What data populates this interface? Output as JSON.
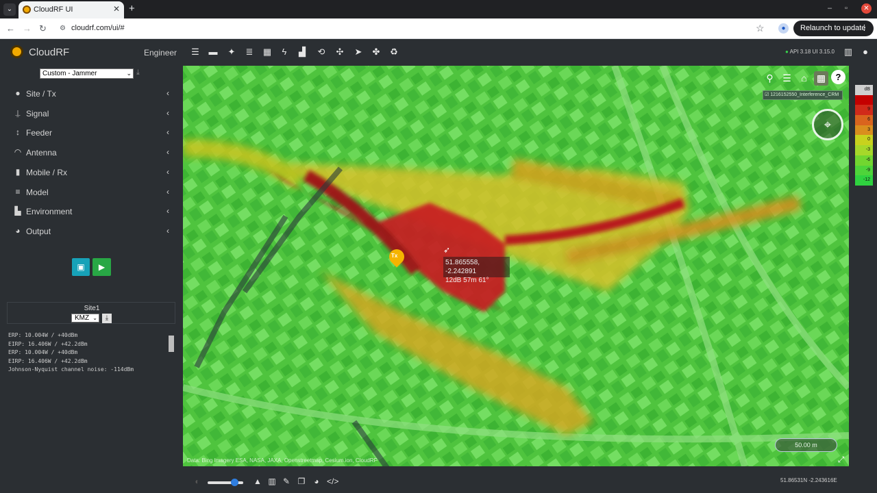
{
  "browser": {
    "tab_title": "CloudRF UI",
    "url": "cloudrf.com/ui/#",
    "relaunch_label": "Relaunch to update"
  },
  "app": {
    "brand": "CloudRF",
    "mode": "Engineer",
    "api_version": "API 3.18 UI 3.15.0",
    "toolbar_icons": [
      "menu-icon",
      "ruler-icon",
      "medal-icon",
      "database-icon",
      "grid-icon",
      "bolt-icon",
      "chart-icon",
      "route-icon",
      "network-icon",
      "send-icon",
      "drone-icon",
      "recycle-icon"
    ]
  },
  "sidebar": {
    "preset": "Custom - Jammer",
    "items": [
      {
        "label": "Site / Tx",
        "icon": "map-pin-icon"
      },
      {
        "label": "Signal",
        "icon": "antenna-tower-icon"
      },
      {
        "label": "Feeder",
        "icon": "updown-arrow-icon"
      },
      {
        "label": "Antenna",
        "icon": "wifi-icon"
      },
      {
        "label": "Mobile / Rx",
        "icon": "mobile-icon"
      },
      {
        "label": "Model",
        "icon": "sliders-icon"
      },
      {
        "label": "Environment",
        "icon": "buildings-icon"
      },
      {
        "label": "Output",
        "icon": "palette-icon"
      }
    ],
    "site_name": "Site1",
    "export_format": "KMZ",
    "log_lines": [
      "ERP: 10.004W / +40dBm",
      "EIRP: 16.406W / +42.2dBm",
      "ERP: 10.004W / +40dBm",
      "EIRP: 16.406W / +42.2dBm",
      "Johnson-Nyquist channel noise: -114dBm"
    ]
  },
  "map": {
    "layer_name": "1216152550_Interference_CRM",
    "tx_label": "Tx",
    "tooltip_coords": "51.865558, -2.242891",
    "tooltip_reading": "12dB 57m 61°",
    "scale_label": "50.00 m",
    "attribution": "Data: Bing Imagery ESA, NASA, JAXA, Openstreetmap, Cesium.ion, CloudRF"
  },
  "legend": {
    "unit": "dB",
    "entries": [
      {
        "label": "",
        "color": "#c40000"
      },
      {
        "label": "9",
        "color": "#d12a1a"
      },
      {
        "label": "6",
        "color": "#d9641e"
      },
      {
        "label": "3",
        "color": "#d98e1e"
      },
      {
        "label": "0",
        "color": "#c8d21e"
      },
      {
        "label": "-3",
        "color": "#a6d82a"
      },
      {
        "label": "-6",
        "color": "#72d630"
      },
      {
        "label": "-9",
        "color": "#4ed43a"
      },
      {
        "label": "-12",
        "color": "#2fd23f"
      }
    ]
  },
  "status": {
    "cursor_coords": "51.86531N -2.243616E"
  }
}
